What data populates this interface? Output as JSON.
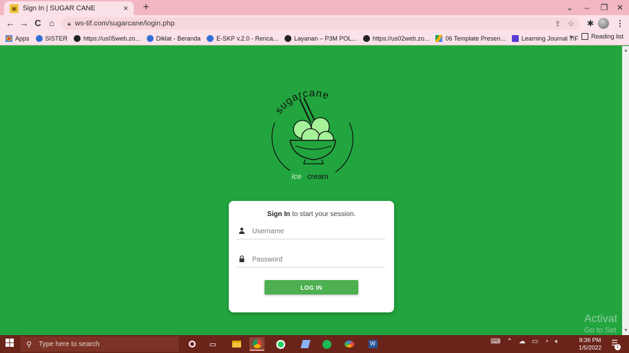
{
  "tab": {
    "title": "Sign In | SUGAR CANE",
    "close": "×",
    "new_tab": "+"
  },
  "window_controls": {
    "dropdown": "⌄",
    "minimize": "–",
    "restore": "❐",
    "close": "✕"
  },
  "toolbar": {
    "back": "←",
    "forward": "→",
    "reload": "C",
    "home": "⌂",
    "url": "ws-tif.com/sugarcane/login.php",
    "share": "⇪",
    "star": "☆",
    "extensions": "✱",
    "menu": "⋮"
  },
  "bookmarks": {
    "items": [
      {
        "label": "Apps",
        "color": "#d9453b",
        "icon": "apps-grid-icon"
      },
      {
        "label": "SISTER",
        "color": "#2f6fd6",
        "icon": "globe-icon"
      },
      {
        "label": "https://us05web.zo...",
        "color": "#222222",
        "icon": "globe-icon"
      },
      {
        "label": "Diklat - Beranda",
        "color": "#2f6fd6",
        "icon": "globe-icon"
      },
      {
        "label": "E-SKP v.2.0 - Renca...",
        "color": "#2f6fd6",
        "icon": "globe-icon"
      },
      {
        "label": "Layanan – P3M POL...",
        "color": "#222222",
        "icon": "globe-icon"
      },
      {
        "label": "https://us02web.zo...",
        "color": "#222222",
        "icon": "globe-icon"
      },
      {
        "label": "06 Template Presen...",
        "color": "#f4b400",
        "icon": "drive-icon"
      },
      {
        "label": "Learning Journal TIF",
        "color": "#5b3fd3",
        "icon": "forms-icon"
      }
    ],
    "more": "»",
    "reading_list": "Reading list"
  },
  "logo": {
    "top_text": "sugarcane",
    "bottom_text_1": "Ice",
    "bottom_text_2": "cream"
  },
  "login": {
    "message_strong": "Sign In",
    "message_rest": " to start your session.",
    "username_placeholder": "Username",
    "password_placeholder": "Password",
    "button": "LOG IN"
  },
  "watermark": {
    "line1": "Activat",
    "line2": "Go to Set"
  },
  "taskbar": {
    "search_placeholder": "Type here to search",
    "time": "8:36 PM",
    "date": "1/5/2022",
    "notifications": "1"
  },
  "colors": {
    "page_bg": "#22a53f",
    "button": "#4caf50",
    "tabstrip": "#f3b7c4",
    "taskbar": "#6b241a"
  }
}
